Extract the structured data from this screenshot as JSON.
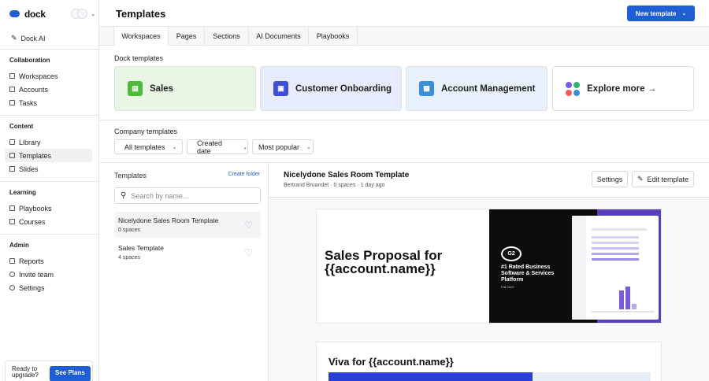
{
  "app": {
    "logo": "dock"
  },
  "sidebar": {
    "ai_label": "Dock AI",
    "sections": [
      {
        "heading": "Collaboration",
        "items": [
          "Workspaces",
          "Accounts",
          "Tasks"
        ]
      },
      {
        "heading": "Content",
        "items": [
          "Library",
          "Templates",
          "Slides"
        ]
      },
      {
        "heading": "Learning",
        "items": [
          "Playbooks",
          "Courses"
        ]
      },
      {
        "heading": "Admin",
        "items": [
          "Reports",
          "Invite team",
          "Settings"
        ]
      }
    ],
    "active_item": "Templates",
    "upgrade": {
      "text": "Ready to upgrade?",
      "button": "See Plans"
    }
  },
  "header": {
    "title": "Templates",
    "new_button": "New template"
  },
  "tabs": [
    "Workspaces",
    "Pages",
    "Sections",
    "AI Documents",
    "Playbooks"
  ],
  "dock_templates": {
    "label": "Dock templates",
    "cards": [
      {
        "label": "Sales",
        "color": "#4cbb3c"
      },
      {
        "label": "Customer Onboarding",
        "color": "#3f4fd6"
      },
      {
        "label": "Account Management",
        "color": "#3b8fd9"
      },
      {
        "label": "Explore more →",
        "color": "#7c5ce6"
      }
    ]
  },
  "company_templates": {
    "label": "Company templates",
    "filters": [
      "All templates",
      "Created date",
      "Most popular"
    ]
  },
  "list": {
    "title": "Templates",
    "create_folder": "Create folder",
    "search_placeholder": "Search by name...",
    "items": [
      {
        "name": "Nicelydone Sales Room Template",
        "spaces": "0 spaces"
      },
      {
        "name": "Sales Template",
        "spaces": "4 spaces"
      }
    ]
  },
  "detail": {
    "title": "Nicelydone Sales Room Template",
    "author": "Bertrand Bruandet",
    "spaces": "0 spaces",
    "updated": "1 day ago",
    "settings_button": "Settings",
    "edit_button": "Edit template",
    "slide1": {
      "heading": "Sales Proposal for {{account.name}}",
      "badge": "G2",
      "rated": "#1 Rated Business Software & Services Platform",
      "season": "Fall 2023"
    },
    "slide2": {
      "heading": "Viva for {{account.name}}"
    }
  }
}
